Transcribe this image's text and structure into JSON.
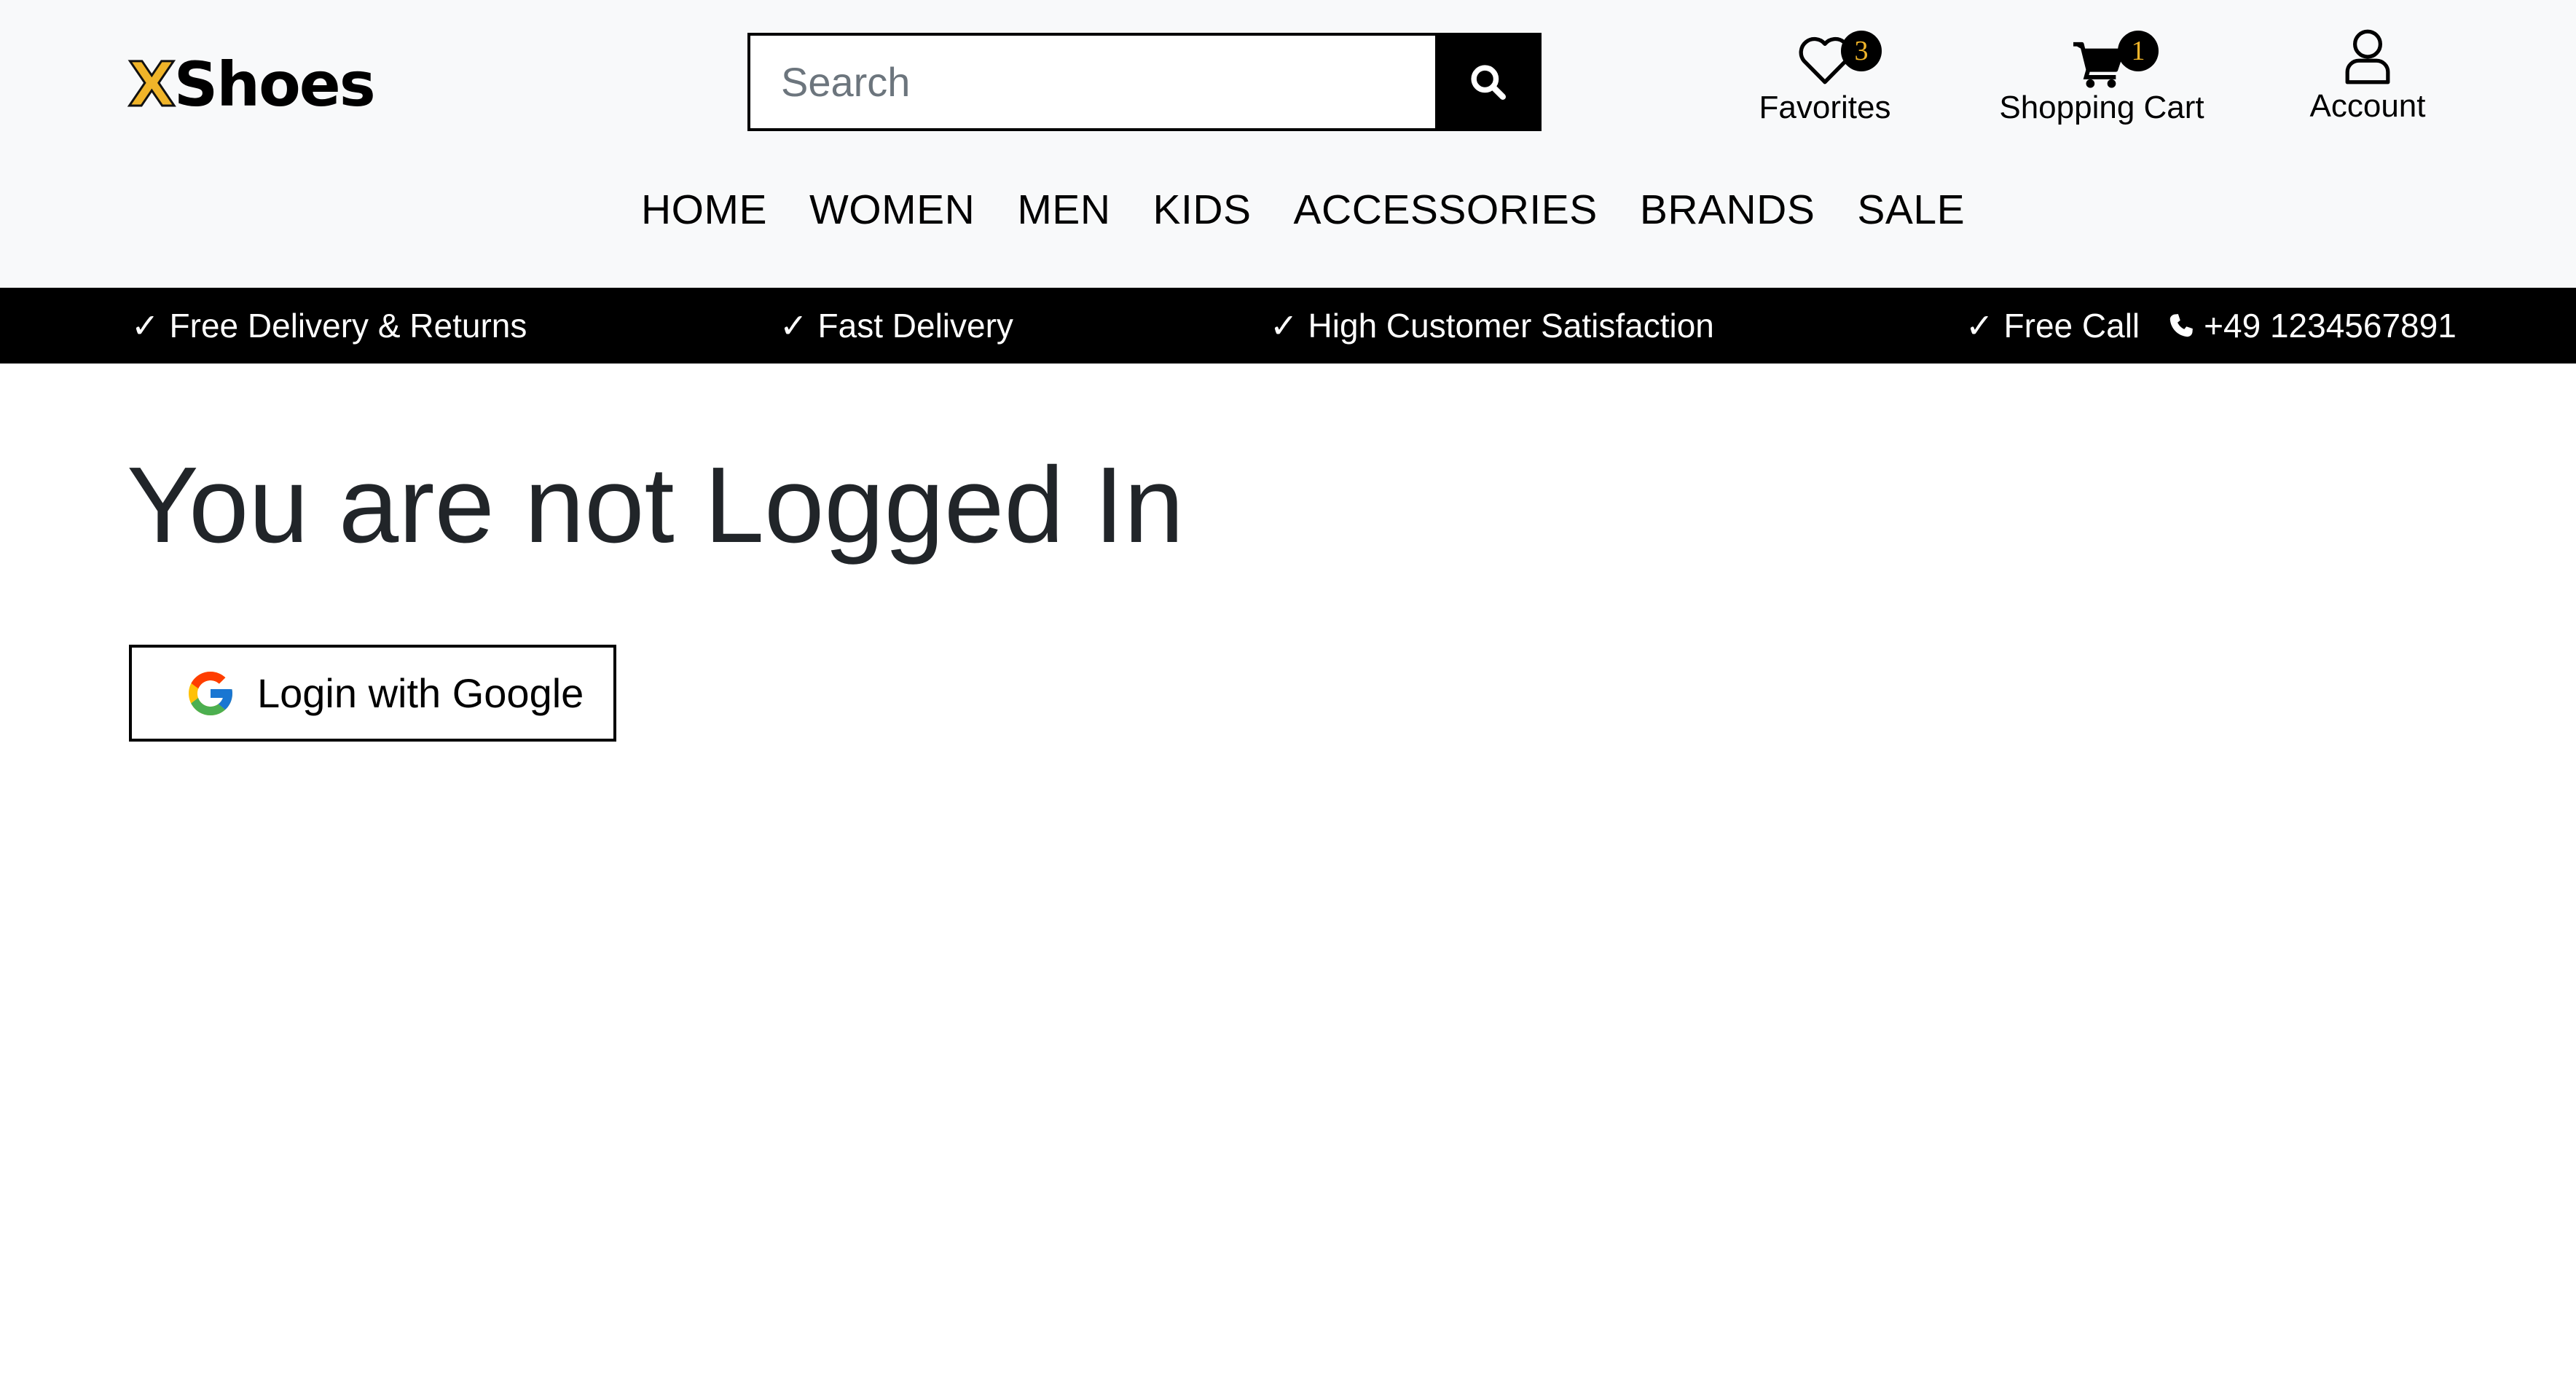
{
  "header": {
    "logo": {
      "first_letter": "X",
      "rest": "Shoes"
    },
    "search": {
      "placeholder": "Search",
      "value": "",
      "icon": "search-icon"
    },
    "favorites": {
      "label": "Favorites",
      "count": "3",
      "icon": "heart-icon"
    },
    "cart": {
      "label": "Shopping Cart",
      "count": "1",
      "icon": "cart-icon"
    },
    "account": {
      "label": "Account",
      "icon": "user-icon"
    },
    "nav": [
      "HOME",
      "WOMEN",
      "MEN",
      "KIDS",
      "ACCESSORIES",
      "BRANDS",
      "SALE"
    ]
  },
  "info_bar": {
    "check": "✓",
    "items": [
      "Free Delivery & Returns",
      "Fast Delivery",
      "High Customer Satisfaction",
      "Free Call"
    ],
    "phone": "+49 1234567891",
    "phone_icon": "phone-icon"
  },
  "main": {
    "title": "You are not Logged In",
    "login_button": {
      "label": "Login with Google",
      "icon": "google-icon"
    }
  },
  "colors": {
    "header_bg": "#f8f9fa",
    "info_bar_bg": "#000000",
    "accent": "#f0b429",
    "text": "#212529"
  }
}
